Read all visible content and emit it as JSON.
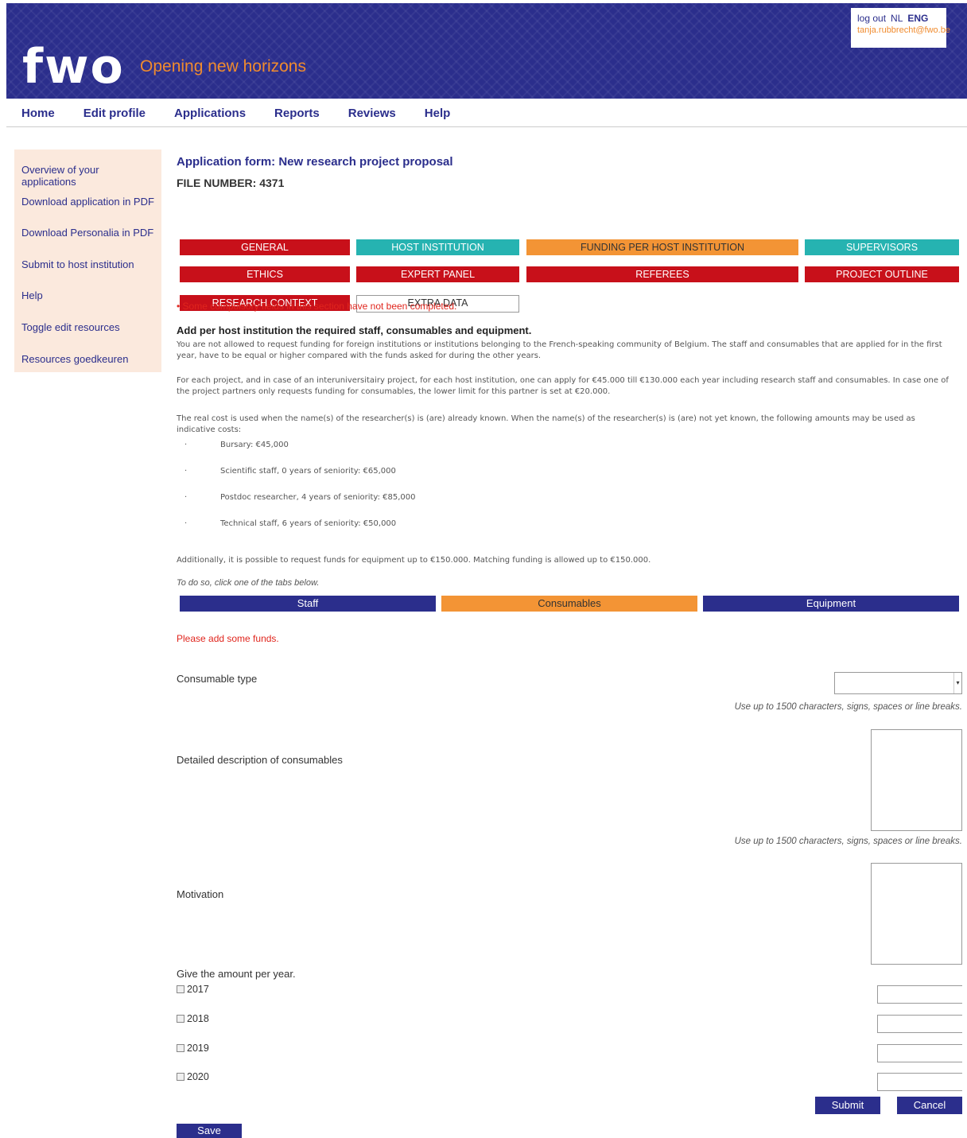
{
  "header": {
    "logo_text": "fwo",
    "tagline": "Opening new horizons",
    "logout": "log out",
    "lang_nl": "NL",
    "lang_eng": "ENG",
    "email": "tanja.rubbrecht@fwo.be"
  },
  "topnav": [
    "Home",
    "Edit profile",
    "Applications",
    "Reports",
    "Reviews",
    "Help"
  ],
  "sidebar": [
    "Overview of your applications",
    "Download application in PDF",
    "Download Personalia in PDF",
    "Submit to host institution",
    "Help",
    "Toggle edit resources",
    "Resources goedkeuren"
  ],
  "main": {
    "title": "Application form: New research project proposal",
    "file_number": "FILE NUMBER: 4371",
    "section_tabs": [
      {
        "label": "GENERAL",
        "color": "#c8101a"
      },
      {
        "label": "HOST INSTITUTION",
        "color": "#26b3b1"
      },
      {
        "label": "FUNDING PER HOST INSTITUTION",
        "color": "#f39435"
      },
      {
        "label": "SUPERVISORS",
        "color": "#26b3b1"
      },
      {
        "label": "ETHICS",
        "color": "#c8101a"
      },
      {
        "label": "EXPERT PANEL",
        "color": "#c8101a"
      },
      {
        "label": "REFEREES",
        "color": "#c8101a"
      },
      {
        "label": "PROJECT OUTLINE",
        "color": "#c8101a"
      },
      {
        "label": "RESEARCH CONTEXT",
        "color": "#c8101a"
      },
      {
        "label": "EXTRA DATA",
        "color": "#ffffff"
      }
    ],
    "warning": "• Some compulsory fields in this section have not been completed.",
    "instr_heading": "Add per host institution the required staff, consumables and equipment.",
    "para1": "You are not allowed to request funding for foreign institutions or institutions belonging to the French-speaking community of Belgium. The staff and consumables that are applied for in the first year, have to be equal or higher compared with the funds asked for during the other years.",
    "para2": "For each project, and in case of an interuniversitairy project, for each host institution, one can apply for €45.000 till €130.000 each year including research staff and consumables. In case one of the project partners only requests funding for consumables, the lower limit for this partner is set at €20.000.",
    "para3": "The real cost is used when the name(s) of the researcher(s) is (are) already known. When the name(s) of the researcher(s) is (are) not yet known, the following amounts may be used as indicative costs:",
    "bullets": [
      "Bursary: €45,000",
      "Scientific staff, 0 years of seniority: €65,000",
      "Postdoc researcher, 4 years of seniority: €85,000",
      "Technical staff, 6 years of seniority: €50,000"
    ],
    "bullet_mark": "·",
    "para4": "Additionally, it is possible to request funds for equipment up to €150.000. Matching funding is allowed up to €150.000.",
    "tabs_note": "To do so, click one of the tabs below.",
    "fund_tabs": [
      "Staff",
      "Consumables",
      "Equipment"
    ],
    "funds_warning": "Please add some funds.",
    "consumable_type_label": "Consumable type",
    "consumable_type_value": "",
    "hint": "Use up to 1500 characters, signs, spaces or line breaks.",
    "description_label": "Detailed description of consumables",
    "motivation_label": "Motivation",
    "amount_heading": "Give the amount per year.",
    "years": [
      "2017",
      "2018",
      "2019",
      "2020"
    ],
    "submit": "Submit",
    "cancel": "Cancel",
    "save": "Save"
  }
}
